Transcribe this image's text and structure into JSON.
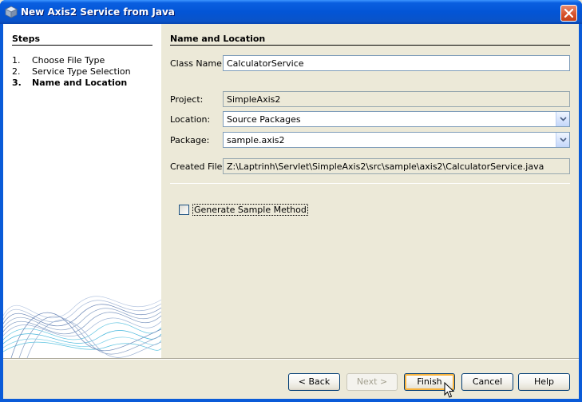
{
  "window": {
    "title": "New Axis2 Service from Java"
  },
  "steps": {
    "title": "Steps",
    "items": [
      {
        "num": "1.",
        "label": "Choose File Type"
      },
      {
        "num": "2.",
        "label": "Service Type Selection"
      },
      {
        "num": "3.",
        "label": "Name and Location"
      }
    ],
    "current_index": 2
  },
  "form": {
    "section_title": "Name and Location",
    "class_name": {
      "label": "Class Name:",
      "value": "CalculatorService"
    },
    "project": {
      "label": "Project:",
      "value": "SimpleAxis2"
    },
    "location": {
      "label": "Location:",
      "value": "Source Packages"
    },
    "package": {
      "label": "Package:",
      "value": "sample.axis2"
    },
    "created_file": {
      "label": "Created File:",
      "value": "Z:\\Laptrinh\\Servlet\\SimpleAxis2\\src\\sample\\axis2\\CalculatorService.java"
    },
    "generate_sample": {
      "label": "Generate Sample Method",
      "checked": false
    }
  },
  "buttons": {
    "back": "< Back",
    "next": "Next >",
    "finish": "Finish",
    "cancel": "Cancel",
    "help": "Help"
  },
  "colors": {
    "titlebar": "#0355d6",
    "accent_focus": "#f8b33e",
    "panel": "#ece9d8"
  }
}
